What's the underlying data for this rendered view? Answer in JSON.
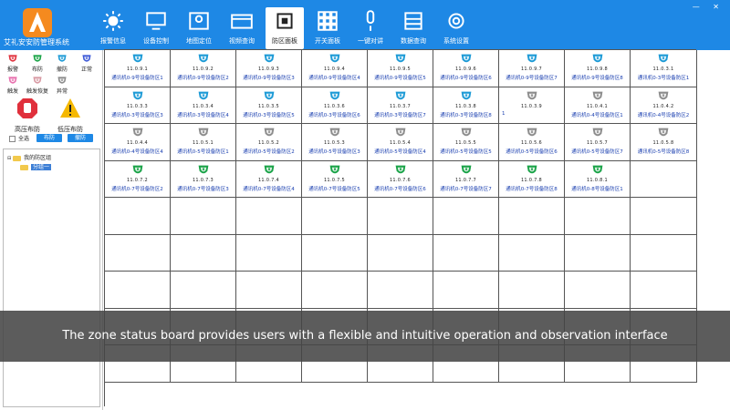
{
  "app": {
    "title": "艾礼安安防管理系统"
  },
  "nav": [
    {
      "label": "报警信息",
      "icon": "sun-icon"
    },
    {
      "label": "设备控制",
      "icon": "monitor-icon"
    },
    {
      "label": "地图定位",
      "icon": "map-pin-icon"
    },
    {
      "label": "视频查询",
      "icon": "video-icon"
    },
    {
      "label": "防区面板",
      "icon": "panel-icon",
      "active": true
    },
    {
      "label": "开关面板",
      "icon": "switch-grid-icon"
    },
    {
      "label": "一键对讲",
      "icon": "microphone-icon"
    },
    {
      "label": "数据查询",
      "icon": "database-icon"
    },
    {
      "label": "系统设置",
      "icon": "gear-icon"
    }
  ],
  "legend": [
    {
      "label": "报警",
      "color": "#e0303c"
    },
    {
      "label": "布防",
      "color": "#19a347"
    },
    {
      "label": "撤防",
      "color": "#1c9ad6"
    },
    {
      "label": "正常",
      "color": "#3f5bd8"
    },
    {
      "label": "触发",
      "color": "#e86fae"
    },
    {
      "label": "触发恢复",
      "color": "#d89aa3"
    },
    {
      "label": "异常",
      "color": "#8c8c8c"
    }
  ],
  "controls": {
    "high_voltage_label": "高压布防",
    "low_voltage_label": "低压布防",
    "select_all_label": "全选",
    "arm_button": "布防",
    "disarm_button": "撤防"
  },
  "tree": {
    "root_label": "我的防区组",
    "child_label": "分组一"
  },
  "zones": [
    {
      "code": "11.0.9.1",
      "name": "通讯机0-9号设备防区1",
      "status": "disarmed"
    },
    {
      "code": "11.0.9.2",
      "name": "通讯机0-9号设备防区2",
      "status": "disarmed"
    },
    {
      "code": "11.0.9.3",
      "name": "通讯机0-9号设备防区3",
      "status": "disarmed"
    },
    {
      "code": "11.0.9.4",
      "name": "通讯机0-9号设备防区4",
      "status": "disarmed"
    },
    {
      "code": "11.0.9.5",
      "name": "通讯机0-9号设备防区5",
      "status": "disarmed"
    },
    {
      "code": "11.0.9.6",
      "name": "通讯机0-9号设备防区6",
      "status": "disarmed"
    },
    {
      "code": "11.0.9.7",
      "name": "通讯机0-9号设备防区7",
      "status": "disarmed"
    },
    {
      "code": "11.0.9.8",
      "name": "通讯机0-9号设备防区8",
      "status": "disarmed"
    },
    {
      "code": "11.0.3.1",
      "name": "通讯机0-3号设备防区1",
      "status": "disarmed"
    },
    {
      "code": "11.0.3.3",
      "name": "通讯机0-3号设备防区3",
      "status": "disarmed"
    },
    {
      "code": "11.0.3.4",
      "name": "通讯机0-3号设备防区4",
      "status": "disarmed"
    },
    {
      "code": "11.0.3.5",
      "name": "通讯机0-3号设备防区5",
      "status": "disarmed"
    },
    {
      "code": "11.0.3.6",
      "name": "通讯机0-3号设备防区6",
      "status": "disarmed"
    },
    {
      "code": "11.0.3.7",
      "name": "通讯机0-3号设备防区7",
      "status": "disarmed"
    },
    {
      "code": "11.0.3.8",
      "name": "通讯机0-3号设备防区8",
      "status": "disarmed"
    },
    {
      "code": "11.0.3.9",
      "name": "1",
      "status": "abnormal"
    },
    {
      "code": "11.0.4.1",
      "name": "通讯机0-4号设备防区1",
      "status": "abnormal"
    },
    {
      "code": "11.0.4.2",
      "name": "通讯机0-4号设备防区2",
      "status": "abnormal"
    },
    {
      "code": "11.0.4.4",
      "name": "通讯机0-4号设备防区4",
      "status": "abnormal"
    },
    {
      "code": "11.0.5.1",
      "name": "通讯机0-5号设备防区1",
      "status": "abnormal"
    },
    {
      "code": "11.0.5.2",
      "name": "通讯机0-5号设备防区2",
      "status": "abnormal"
    },
    {
      "code": "11.0.5.3",
      "name": "通讯机0-5号设备防区3",
      "status": "abnormal"
    },
    {
      "code": "11.0.5.4",
      "name": "通讯机0-5号设备防区4",
      "status": "abnormal"
    },
    {
      "code": "11.0.5.5",
      "name": "通讯机0-5号设备防区5",
      "status": "abnormal"
    },
    {
      "code": "11.0.5.6",
      "name": "通讯机0-5号设备防区6",
      "status": "abnormal"
    },
    {
      "code": "11.0.5.7",
      "name": "通讯机0-5号设备防区7",
      "status": "abnormal"
    },
    {
      "code": "11.0.5.8",
      "name": "通讯机0-5号设备防区8",
      "status": "abnormal"
    },
    {
      "code": "11.0.7.2",
      "name": "通讯机0-7号设备防区2",
      "status": "armed"
    },
    {
      "code": "11.0.7.3",
      "name": "通讯机0-7号设备防区3",
      "status": "armed"
    },
    {
      "code": "11.0.7.4",
      "name": "通讯机0-7号设备防区4",
      "status": "armed"
    },
    {
      "code": "11.0.7.5",
      "name": "通讯机0-7号设备防区5",
      "status": "armed"
    },
    {
      "code": "11.0.7.6",
      "name": "通讯机0-7号设备防区6",
      "status": "armed"
    },
    {
      "code": "11.0.7.7",
      "name": "通讯机0-7号设备防区7",
      "status": "armed"
    },
    {
      "code": "11.0.7.8",
      "name": "通讯机0-7号设备防区8",
      "status": "armed"
    },
    {
      "code": "11.0.8.1",
      "name": "通讯机0-8号设备防区1",
      "status": "armed"
    }
  ],
  "status_colors": {
    "disarmed": "#1c9ad6",
    "abnormal": "#8c8c8c",
    "armed": "#19a347"
  },
  "caption": "The zone status board provides users with a flexible and intuitive operation and observation interface"
}
